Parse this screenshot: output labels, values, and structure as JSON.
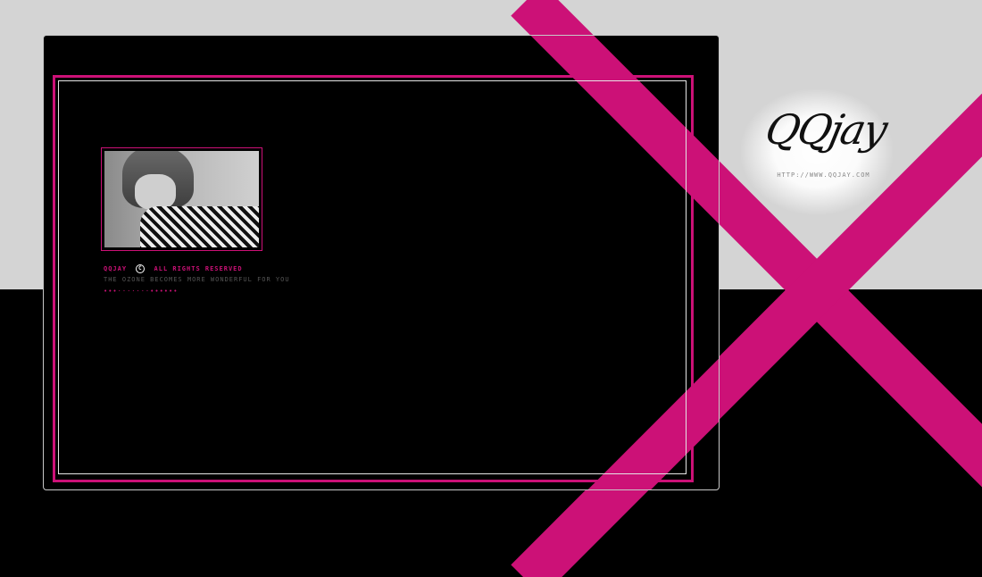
{
  "logo": {
    "script_text": "QQjay",
    "url_text": "HTTP://WWW.QQJAY.COM"
  },
  "footer": {
    "brand": "QQJAY",
    "copyright_symbol": "C",
    "rights": "ALL RIGHTS RESERVED",
    "tagline": "THE OZONE BECOMES MORE WONDERFUL FOR YOU",
    "dots": "•••·······••••••"
  },
  "colors": {
    "accent": "#cc1177",
    "background_light": "#d4d4d4",
    "background_dark": "#000000"
  }
}
